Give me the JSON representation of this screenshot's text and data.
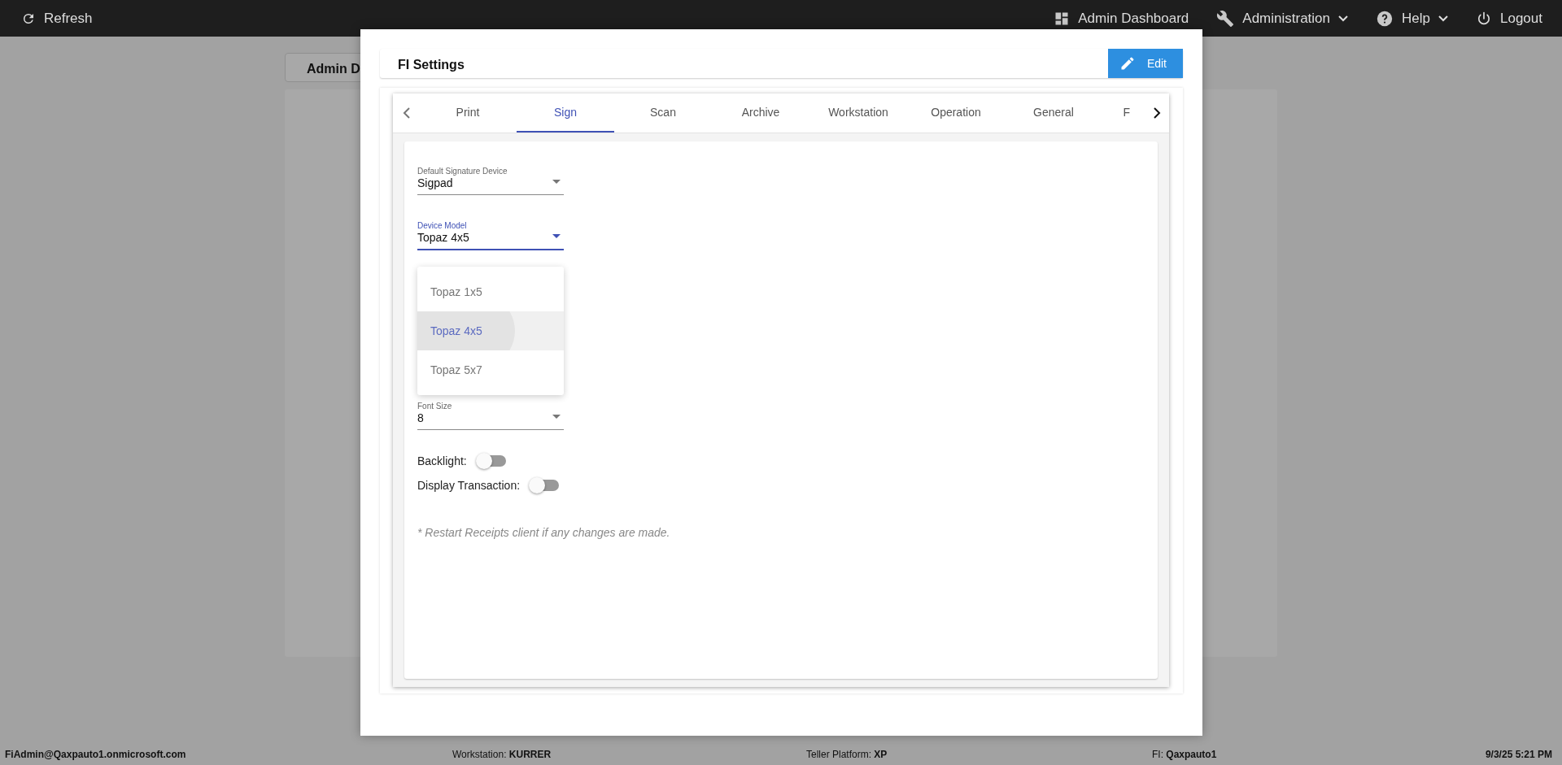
{
  "top_bar": {
    "refresh": "Refresh",
    "items": [
      {
        "kind": "dashboard",
        "label": "Admin Dashboard",
        "dropdown": false
      },
      {
        "kind": "wrench",
        "label": "Administration",
        "dropdown": true
      },
      {
        "kind": "help",
        "label": "Help",
        "dropdown": true
      },
      {
        "kind": "power",
        "label": "Logout",
        "dropdown": false
      }
    ]
  },
  "background": {
    "tab": "Admin D"
  },
  "dialog": {
    "title": "FI Settings",
    "edit_button": "Edit",
    "tabs": [
      {
        "label": "Print",
        "selected": false
      },
      {
        "label": "Sign",
        "selected": true
      },
      {
        "label": "Scan",
        "selected": false
      },
      {
        "label": "Archive",
        "selected": false
      },
      {
        "label": "Workstation",
        "selected": false
      },
      {
        "label": "Operation",
        "selected": false
      },
      {
        "label": "General",
        "selected": false
      },
      {
        "label": "F",
        "selected": false
      }
    ],
    "fields": [
      {
        "label": "Default Signature Device",
        "value": "Sigpad",
        "focused": false
      },
      {
        "label": "Device Model",
        "value": "Topaz 4x5",
        "focused": true
      },
      {
        "label": "Font Size",
        "value": "8",
        "focused": false
      }
    ],
    "menu": [
      {
        "label": "Topaz 1x5",
        "selected": false
      },
      {
        "label": "Topaz 4x5",
        "selected": true
      },
      {
        "label": "Topaz 5x7",
        "selected": false
      }
    ],
    "toggles": [
      {
        "label": "Backlight:",
        "on": false
      },
      {
        "label": "Display Transaction:",
        "on": false
      }
    ],
    "note": "* Restart Receipts client if any changes are made."
  },
  "status_bar": {
    "user": "FiAdmin@Qaxpauto1.onmicrosoft.com",
    "items": [
      "Workstation: **KURRER**",
      "Teller Platform: **XP**",
      "FI: **Qaxpauto1**"
    ],
    "datetime": "9/3/25 5:21 PM"
  }
}
